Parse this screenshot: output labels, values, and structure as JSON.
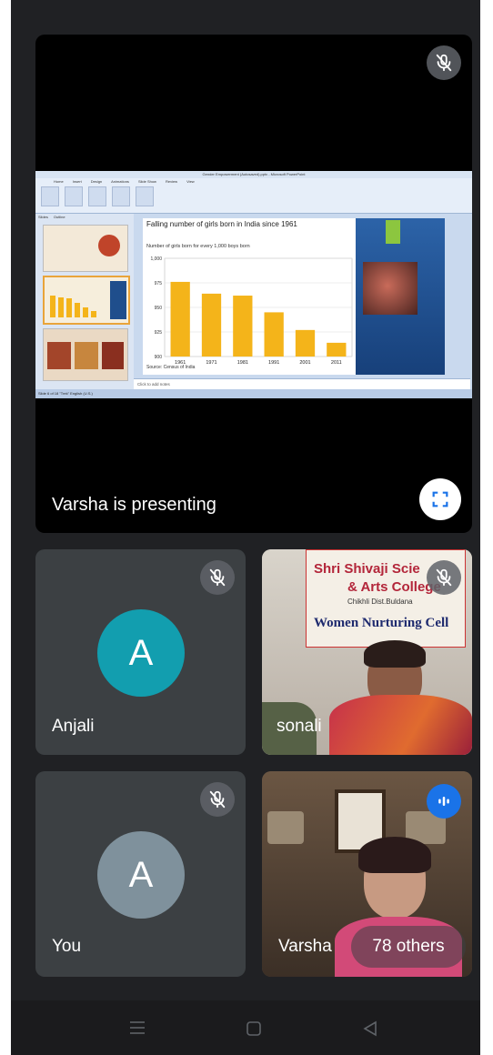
{
  "presentation": {
    "status_text": "Varsha is presenting",
    "window_title": "Gender Empowerment (Autosaved).pptx - Microsoft PowerPoint",
    "ribbon_tabs": [
      "Home",
      "Insert",
      "Design",
      "Animations",
      "Slide Show",
      "Review",
      "View"
    ],
    "panel_tabs": [
      "Slides",
      "Outline"
    ],
    "notes_placeholder": "Click to add notes",
    "status_bar": "Slide 6 of 18   \"Trek\"   English (U.S.)"
  },
  "slide": {
    "title": "Falling number of girls born in India since 1961",
    "subtitle": "Number of girls born for every 1,000 boys born",
    "source": "Source: Census of India"
  },
  "chart_data": {
    "type": "bar",
    "title": "Falling number of girls born in India since 1961",
    "subtitle": "Number of girls born for every 1,000 boys born",
    "categories": [
      "1961",
      "1971",
      "1981",
      "1991",
      "2001",
      "2011"
    ],
    "values": [
      976,
      964,
      962,
      945,
      927,
      914
    ],
    "ylim": [
      900,
      1000
    ],
    "yticks": [
      900,
      925,
      950,
      975,
      "1,000"
    ],
    "grid": true,
    "bar_color": "#f4b41a"
  },
  "participants": {
    "anjali": {
      "name": "Anjali",
      "initial": "A",
      "avatar_color": "#129eaf"
    },
    "sonali": {
      "name": "sonali",
      "banner_line1": "Shri Shivaji Scie",
      "banner_line2": "& Arts College",
      "banner_line3": "Chikhli Dist.Buldana",
      "banner_line4": "Women Nurturing Cell"
    },
    "you": {
      "name": "You",
      "initial": "A",
      "avatar_color": "#8ab4f8"
    },
    "varsha": {
      "name": "Varsha",
      "others_label": "78 others"
    }
  },
  "colors": {
    "background": "#202124",
    "tile": "#3c4043",
    "accent": "#1a73e8"
  }
}
